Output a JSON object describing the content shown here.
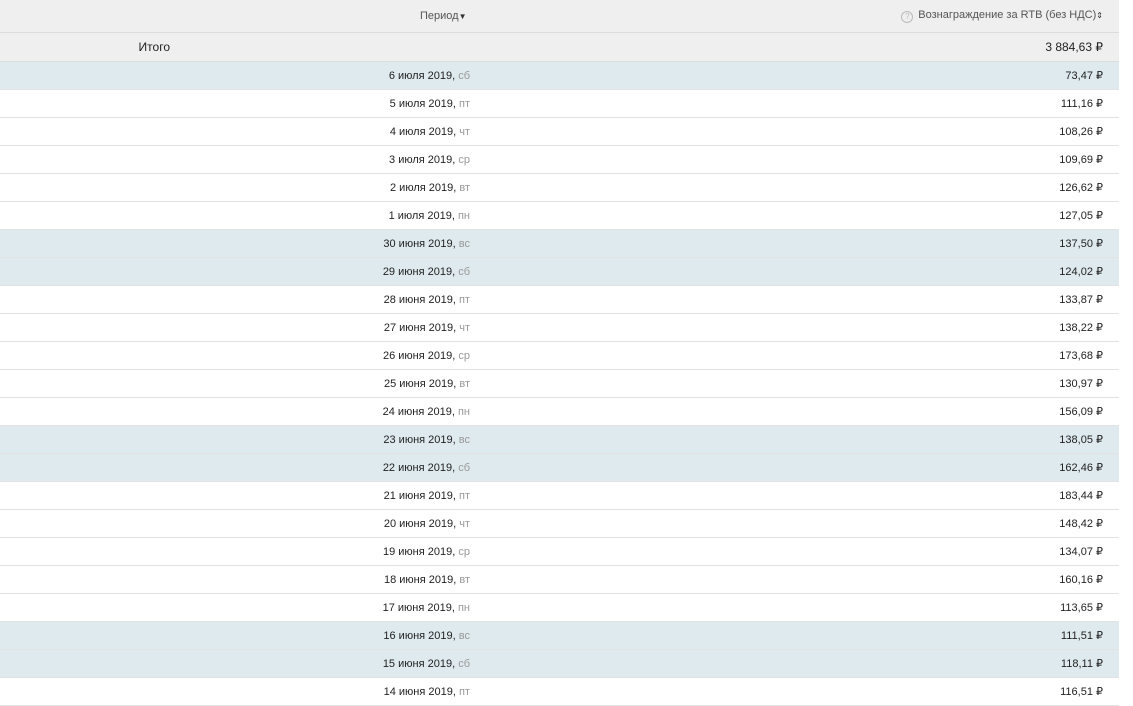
{
  "header": {
    "period": "Период",
    "period_sort": "▼",
    "reward": "Вознаграждение за RTB (без НДС)",
    "reward_sort": "⇕",
    "help": "?"
  },
  "total": {
    "label": "Итого",
    "value": "3 884,63 ₽"
  },
  "rows": [
    {
      "date": "6 июля 2019",
      "dow": "сб",
      "value": "73,47 ₽",
      "weekend": true
    },
    {
      "date": "5 июля 2019",
      "dow": "пт",
      "value": "111,16 ₽",
      "weekend": false
    },
    {
      "date": "4 июля 2019",
      "dow": "чт",
      "value": "108,26 ₽",
      "weekend": false
    },
    {
      "date": "3 июля 2019",
      "dow": "ср",
      "value": "109,69 ₽",
      "weekend": false
    },
    {
      "date": "2 июля 2019",
      "dow": "вт",
      "value": "126,62 ₽",
      "weekend": false
    },
    {
      "date": "1 июля 2019",
      "dow": "пн",
      "value": "127,05 ₽",
      "weekend": false
    },
    {
      "date": "30 июня 2019",
      "dow": "вс",
      "value": "137,50 ₽",
      "weekend": true
    },
    {
      "date": "29 июня 2019",
      "dow": "сб",
      "value": "124,02 ₽",
      "weekend": true
    },
    {
      "date": "28 июня 2019",
      "dow": "пт",
      "value": "133,87 ₽",
      "weekend": false
    },
    {
      "date": "27 июня 2019",
      "dow": "чт",
      "value": "138,22 ₽",
      "weekend": false
    },
    {
      "date": "26 июня 2019",
      "dow": "ср",
      "value": "173,68 ₽",
      "weekend": false
    },
    {
      "date": "25 июня 2019",
      "dow": "вт",
      "value": "130,97 ₽",
      "weekend": false
    },
    {
      "date": "24 июня 2019",
      "dow": "пн",
      "value": "156,09 ₽",
      "weekend": false
    },
    {
      "date": "23 июня 2019",
      "dow": "вс",
      "value": "138,05 ₽",
      "weekend": true
    },
    {
      "date": "22 июня 2019",
      "dow": "сб",
      "value": "162,46 ₽",
      "weekend": true
    },
    {
      "date": "21 июня 2019",
      "dow": "пт",
      "value": "183,44 ₽",
      "weekend": false
    },
    {
      "date": "20 июня 2019",
      "dow": "чт",
      "value": "148,42 ₽",
      "weekend": false
    },
    {
      "date": "19 июня 2019",
      "dow": "ср",
      "value": "134,07 ₽",
      "weekend": false
    },
    {
      "date": "18 июня 2019",
      "dow": "вт",
      "value": "160,16 ₽",
      "weekend": false
    },
    {
      "date": "17 июня 2019",
      "dow": "пн",
      "value": "113,65 ₽",
      "weekend": false
    },
    {
      "date": "16 июня 2019",
      "dow": "вс",
      "value": "111,51 ₽",
      "weekend": true
    },
    {
      "date": "15 июня 2019",
      "dow": "сб",
      "value": "118,11 ₽",
      "weekend": true
    },
    {
      "date": "14 июня 2019",
      "dow": "пт",
      "value": "116,51 ₽",
      "weekend": false
    }
  ]
}
